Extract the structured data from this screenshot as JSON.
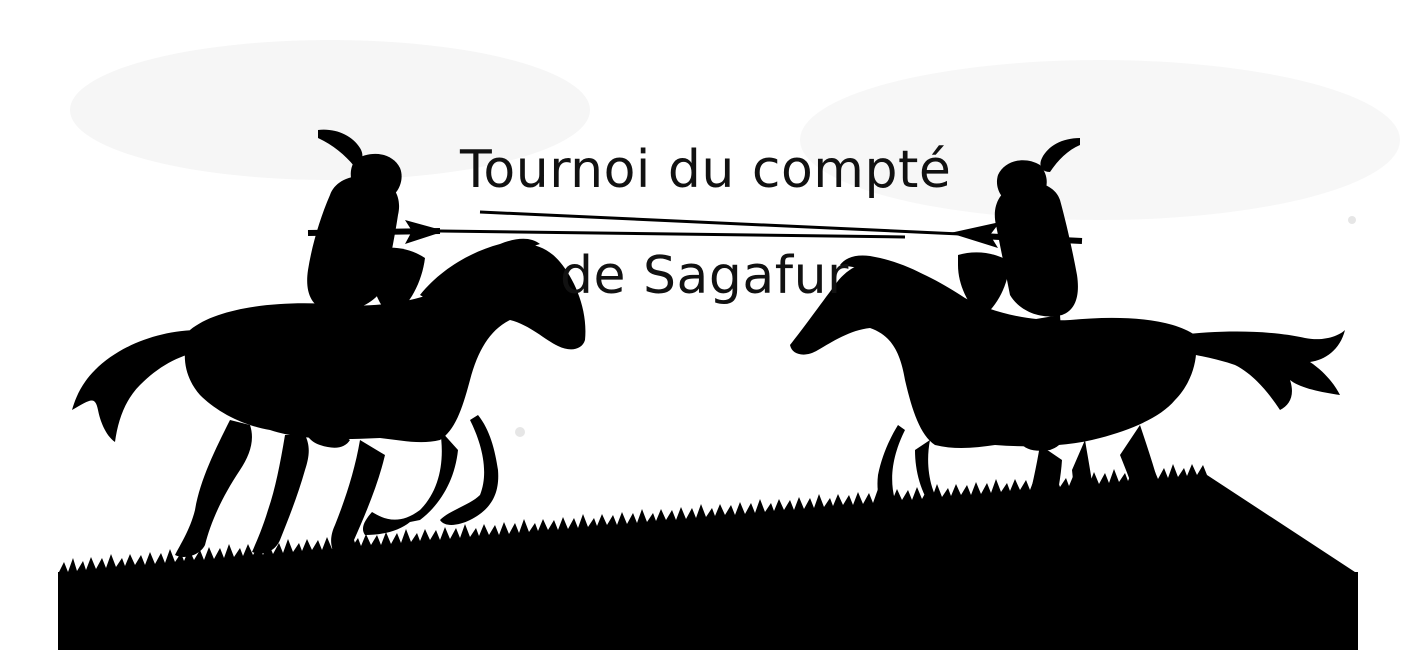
{
  "title": {
    "line1": "Tournoi du compté",
    "line2": "de Sagafur"
  },
  "scene": {
    "subject": "two jousting knights on galloping horses, silhouettes",
    "background_color": "#ffffff",
    "silhouette_color": "#000000",
    "ground_color": "#000000"
  },
  "icons": {
    "left_knight": "knight-horse-silhouette-icon",
    "right_knight": "knight-horse-silhouette-icon",
    "watermark": "watermark-icon"
  }
}
